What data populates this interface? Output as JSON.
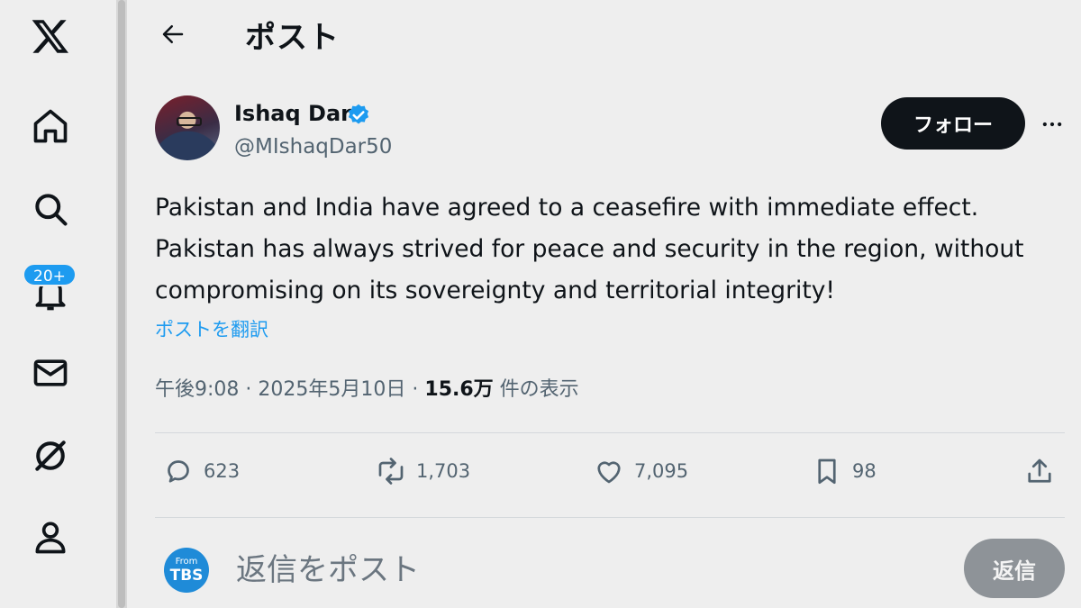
{
  "nav": {
    "items": [
      {
        "name": "x-logo-icon"
      },
      {
        "name": "home-icon"
      },
      {
        "name": "search-icon"
      },
      {
        "name": "bell-icon"
      },
      {
        "name": "mail-icon"
      },
      {
        "name": "grok-icon"
      },
      {
        "name": "profile-icon"
      }
    ],
    "notification_badge": "20+"
  },
  "header": {
    "back_icon": "arrow-left-icon",
    "title": "ポスト"
  },
  "post": {
    "author": {
      "display_name": "Ishaq Dar",
      "handle": "@MIshaqDar50",
      "verified": true
    },
    "follow_label": "フォロー",
    "text": "Pakistan and India  have agreed to a ceasefire with immediate effect.\nPakistan has always strived for peace and security in the region, without\ncompromising on its sovereignty and territorial integrity!",
    "translate_label": "ポストを翻訳",
    "time": "午後9:08",
    "date": "2025年5月10日",
    "separator": "·",
    "views_count": "15.6万",
    "views_label": "件の表示"
  },
  "actions": {
    "replies": "623",
    "reposts": "1,703",
    "likes": "7,095",
    "bookmarks": "98"
  },
  "reply": {
    "avatar_line1": "From",
    "avatar_line2": "TBS",
    "placeholder": "返信をポスト",
    "button_label": "返信"
  },
  "colors": {
    "accent": "#1d9bf0",
    "background": "#eeeeee",
    "text": "#0f1419",
    "muted": "#536471"
  }
}
